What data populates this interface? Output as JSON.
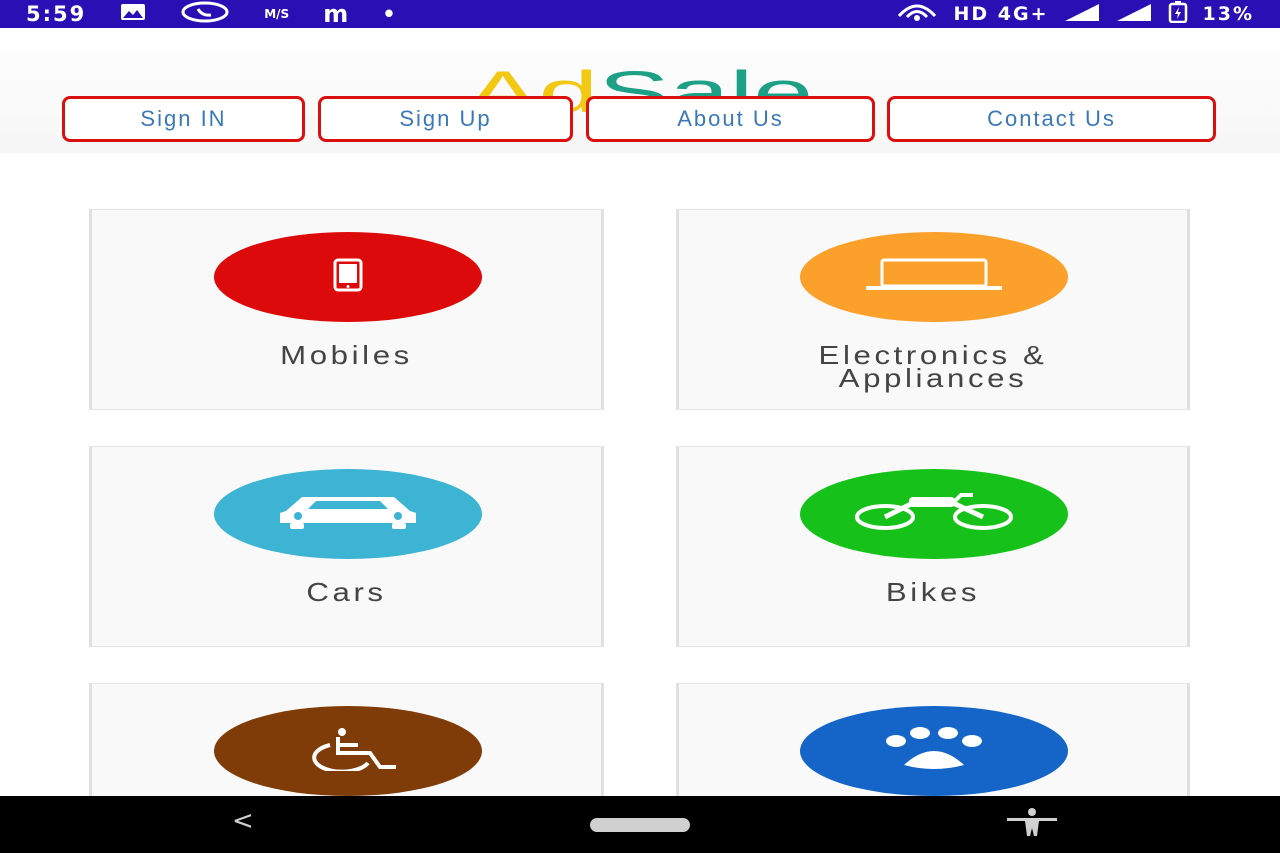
{
  "status_bar": {
    "time": "5:59",
    "mobile_data_label": "M/S",
    "app_letter": "m",
    "dot": "•",
    "network_labels": "HD 4G+",
    "battery_percent": "13%"
  },
  "header": {
    "logo_part1": "Ad",
    "logo_part2": "Sale",
    "nav": {
      "sign_in": "Sign IN",
      "sign_up": "Sign Up",
      "about": "About Us",
      "contact": "Contact Us"
    }
  },
  "categories": [
    {
      "label": "Mobiles",
      "icon": "mobile-phone-icon",
      "color": "#dc0a0a"
    },
    {
      "label": "Electronics &\nAppliances",
      "icon": "laptop-icon",
      "color": "#fba02b"
    },
    {
      "label": "Cars",
      "icon": "car-icon",
      "color": "#3eb4d4"
    },
    {
      "label": "Bikes",
      "icon": "motorbike-icon",
      "color": "#16c21a"
    },
    {
      "label": "",
      "icon": "wheelchair-icon",
      "color": "#7f3c08"
    },
    {
      "label": "",
      "icon": "paw-icon",
      "color": "#1565c8"
    }
  ],
  "android_nav": {
    "back_glyph": "<"
  },
  "colors": {
    "status_bar": "#2a0fb4",
    "button_border": "#d90f10",
    "button_text": "#3a78b8",
    "logo_yellow": "#f2c813",
    "logo_green": "#1da085"
  }
}
